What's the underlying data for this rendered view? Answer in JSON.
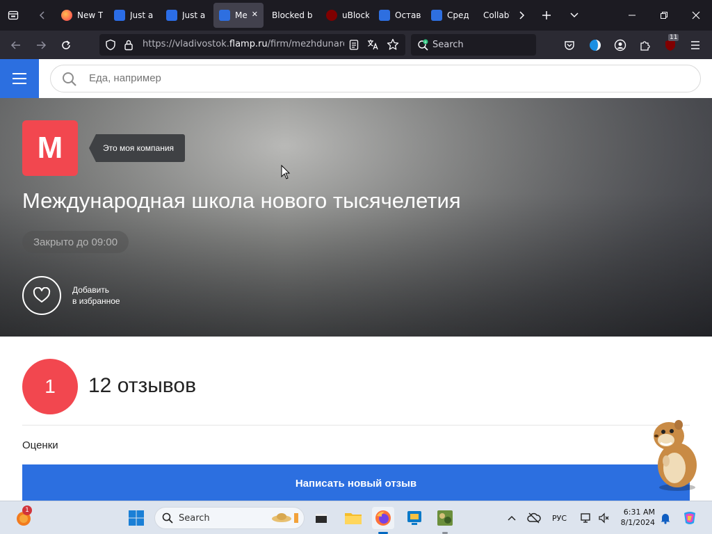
{
  "browser": {
    "tabs": [
      {
        "label": "New T",
        "icon": "firefox-icon",
        "favclass": "fav-ff",
        "active": false
      },
      {
        "label": "Just a",
        "icon": "link-icon",
        "favclass": "fav-link",
        "active": false
      },
      {
        "label": "Just a",
        "icon": "link-icon",
        "favclass": "fav-link",
        "active": false
      },
      {
        "label": "Me",
        "icon": "flamp-icon",
        "favclass": "fav-flamp",
        "active": true
      },
      {
        "label": "Blocked b",
        "icon": "",
        "favclass": "",
        "active": false
      },
      {
        "label": "uBlock",
        "icon": "ublock-icon",
        "favclass": "fav-ublock",
        "active": false
      },
      {
        "label": "Остав",
        "icon": "flamp-icon",
        "favclass": "fav-flamp",
        "active": false
      },
      {
        "label": "Сред",
        "icon": "flamp-icon",
        "favclass": "fav-flamp",
        "active": false
      },
      {
        "label": "CollabV",
        "icon": "",
        "favclass": "",
        "active": false
      }
    ],
    "url_scheme": "https://vladivostok.",
    "url_host": "flamp.ru",
    "url_path": "/firm/mezhdunaroc",
    "search_placeholder": "Search",
    "extensions_badge": "11"
  },
  "site": {
    "search_placeholder": "Еда, например",
    "logo_letter": "M",
    "my_company_label": "Это моя компания",
    "company_name": "Международная школа нового тысячелетия",
    "status": "Закрыто до 09:00",
    "favorite_line1": "Добавить",
    "favorite_line2": "в избранное",
    "rating": "1",
    "reviews_count": "12 отзывов",
    "ratings_label": "Оценки",
    "write_review_label": "Написать новый отзыв"
  },
  "taskbar": {
    "search_label": "Search",
    "notification_badge": "1",
    "language": "РУС",
    "time": "6:31 AM",
    "date": "8/1/2024"
  },
  "colors": {
    "accent_blue": "#2c6fe0",
    "brand_red": "#f2474f"
  }
}
